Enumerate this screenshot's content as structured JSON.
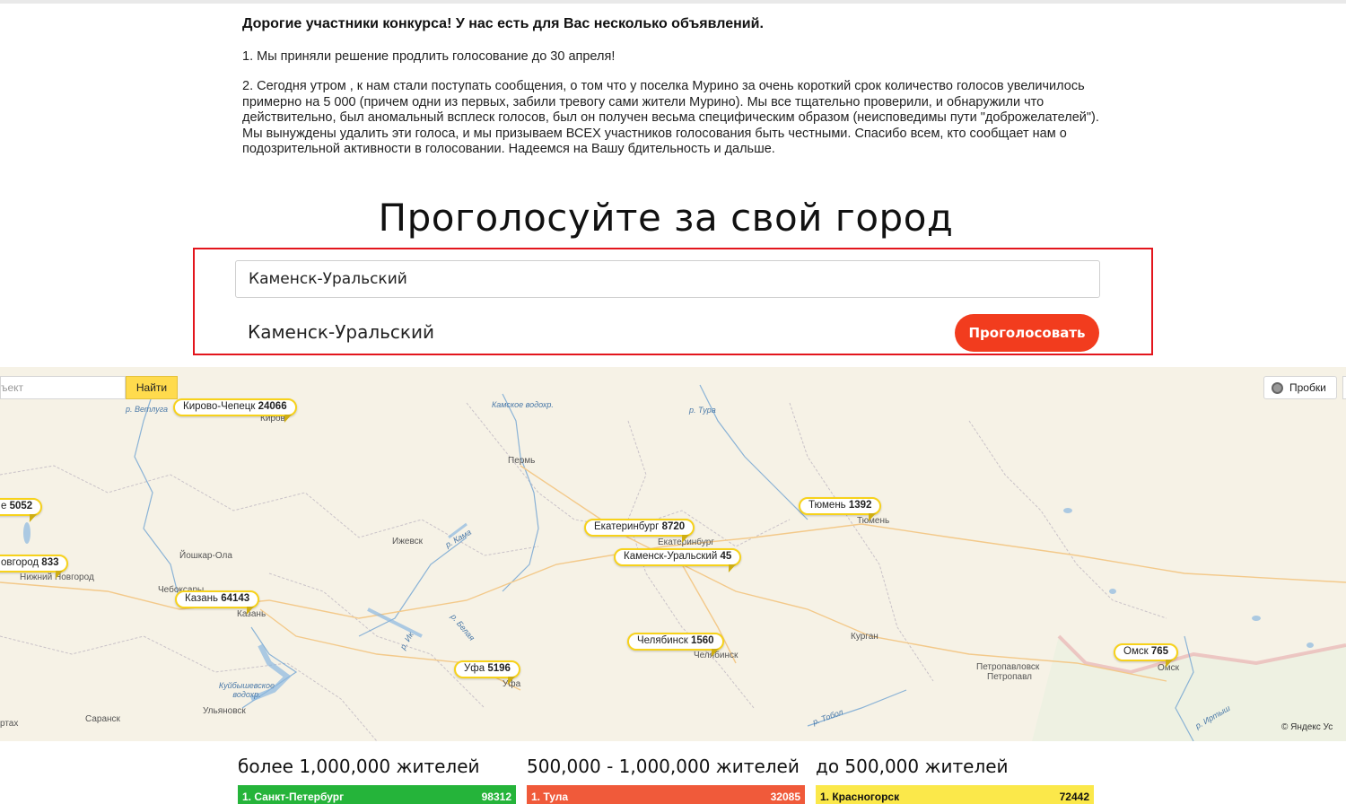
{
  "announcement": {
    "heading": "Дорогие участники конкурса! У нас есть для Вас несколько объявлений.",
    "item1": "1. Мы приняли решение продлить голосование до 30 апреля!",
    "item2": "2. Сегодня утром , к нам стали поступать сообщения, о том что у поселка Мурино за очень короткий срок количество голосов увеличилось примерно на 5 000 (причем одни из первых, забили тревогу сами жители Мурино). Мы все тщательно проверили, и обнаружили что действительно, был аномальный всплеск голосов, был он получен весьма специфическим образом (неисповедимы пути \"доброжелателей\"). Мы вынуждены удалить эти голоса, и мы призываем ВСЕХ участников голосования быть честными. Спасибо всем, кто сообщает нам о подозрительной активности в голосовании. Надеемся на Вашу бдительность и дальше."
  },
  "vote": {
    "title": "Проголосуйте за свой город",
    "input_value": "Каменск-Уральский",
    "selected_city": "Каменск-Уральский",
    "button_label": "Проголосовать",
    "accent_color": "#f23c1e",
    "highlight_color": "#e3151c"
  },
  "map": {
    "search_placeholder": "ъект",
    "find_button": "Найти",
    "traffic_button": "Пробки",
    "copyright": "© Яндекс Ус",
    "pins": [
      {
        "city": "Кирово-Чепецк",
        "votes": "24066"
      },
      {
        "city": "е",
        "votes": "5052"
      },
      {
        "city": "овгород",
        "votes": "833"
      },
      {
        "city": "Казань",
        "votes": "64143"
      },
      {
        "city": "Уфа",
        "votes": "5196"
      },
      {
        "city": "Екатеринбург",
        "votes": "8720"
      },
      {
        "city": "Каменск-Уральский",
        "votes": "45"
      },
      {
        "city": "Челябинск",
        "votes": "1560"
      },
      {
        "city": "Тюмень",
        "votes": "1392"
      },
      {
        "city": "Омск",
        "votes": "765"
      }
    ],
    "labels": {
      "kirov": "Киров",
      "perm": "Пермь",
      "izhevsk": "Ижевск",
      "yoshkar_ola": "Йошкар-Ола",
      "nizhniy": "Нижний Новгород",
      "cheboksary": "Чебоксары",
      "kazan": "Казань",
      "ekb": "Екатеринбург",
      "tyumen": "Тюмень",
      "kurgan": "Курган",
      "chelyabinsk": "Челябинск",
      "petropavlovsk": "Петропавловск",
      "petropavl": "Петропавл",
      "omsk": "Омск",
      "ufa": "Уфа",
      "saransk": "Саранск",
      "ulyanovsk": "Ульяновск",
      "astrakhan": "ртах"
    },
    "rivers": {
      "vetluga": "р. Ветлуга",
      "kama_res": "Камское водохр.",
      "tura": "р. Тура",
      "kama": "р. Кама",
      "belaya": "р. Белая",
      "ik": "р. Ик",
      "kuybysh": "Куйбышевское водохр.",
      "tobol": "р. Тобол",
      "irtysh": "р. Иртыш"
    }
  },
  "rankings": [
    {
      "heading": "более 1,000,000 жителей",
      "first_city": "1. Санкт-Петербург",
      "first_votes": "98312",
      "color": "#25b43a"
    },
    {
      "heading": "500,000 - 1,000,000 жителей",
      "first_city": "1. Тула",
      "first_votes": "32085",
      "color": "#f05a3a"
    },
    {
      "heading": "до 500,000 жителей",
      "first_city": "1. Красногорск",
      "first_votes": "72442",
      "color": "#fbe84a"
    }
  ]
}
